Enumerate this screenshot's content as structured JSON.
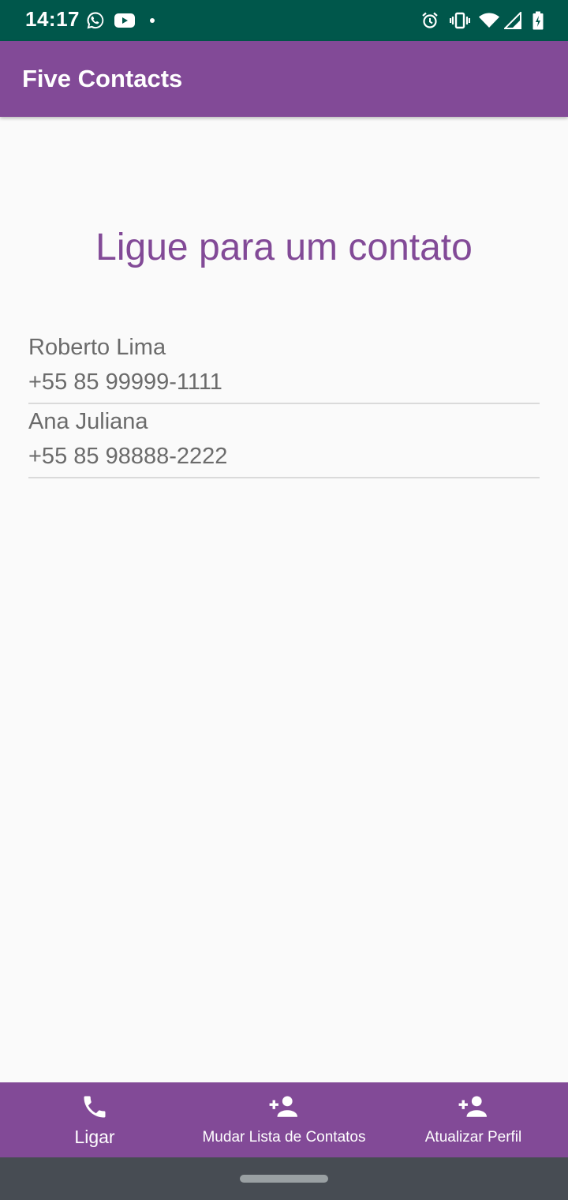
{
  "status_bar": {
    "time": "14:17",
    "left_icons": [
      "whatsapp-icon",
      "youtube-icon",
      "dot-icon"
    ],
    "right_icons": [
      "alarm-icon",
      "vibrate-icon",
      "wifi-icon",
      "signal-icon",
      "battery-charging-icon"
    ]
  },
  "app_bar": {
    "title": "Five Contacts"
  },
  "main": {
    "heading": "Ligue para um contato",
    "contacts": [
      {
        "name": "Roberto Lima",
        "phone": "+55 85 99999-1111"
      },
      {
        "name": "Ana Juliana",
        "phone": "+55 85 98888-2222"
      }
    ]
  },
  "bottom_nav": {
    "items": [
      {
        "label": "Ligar",
        "icon": "phone-icon",
        "active": true
      },
      {
        "label": "Mudar Lista de Contatos",
        "icon": "person-add-icon",
        "active": false
      },
      {
        "label": "Atualizar Perfil",
        "icon": "person-add-icon",
        "active": false
      }
    ]
  },
  "colors": {
    "status_bar": "#00574b",
    "primary": "#824a97",
    "background": "#fafafa",
    "text_secondary": "#6b6b6b",
    "divider": "#dadada",
    "system_nav": "#474c53"
  }
}
